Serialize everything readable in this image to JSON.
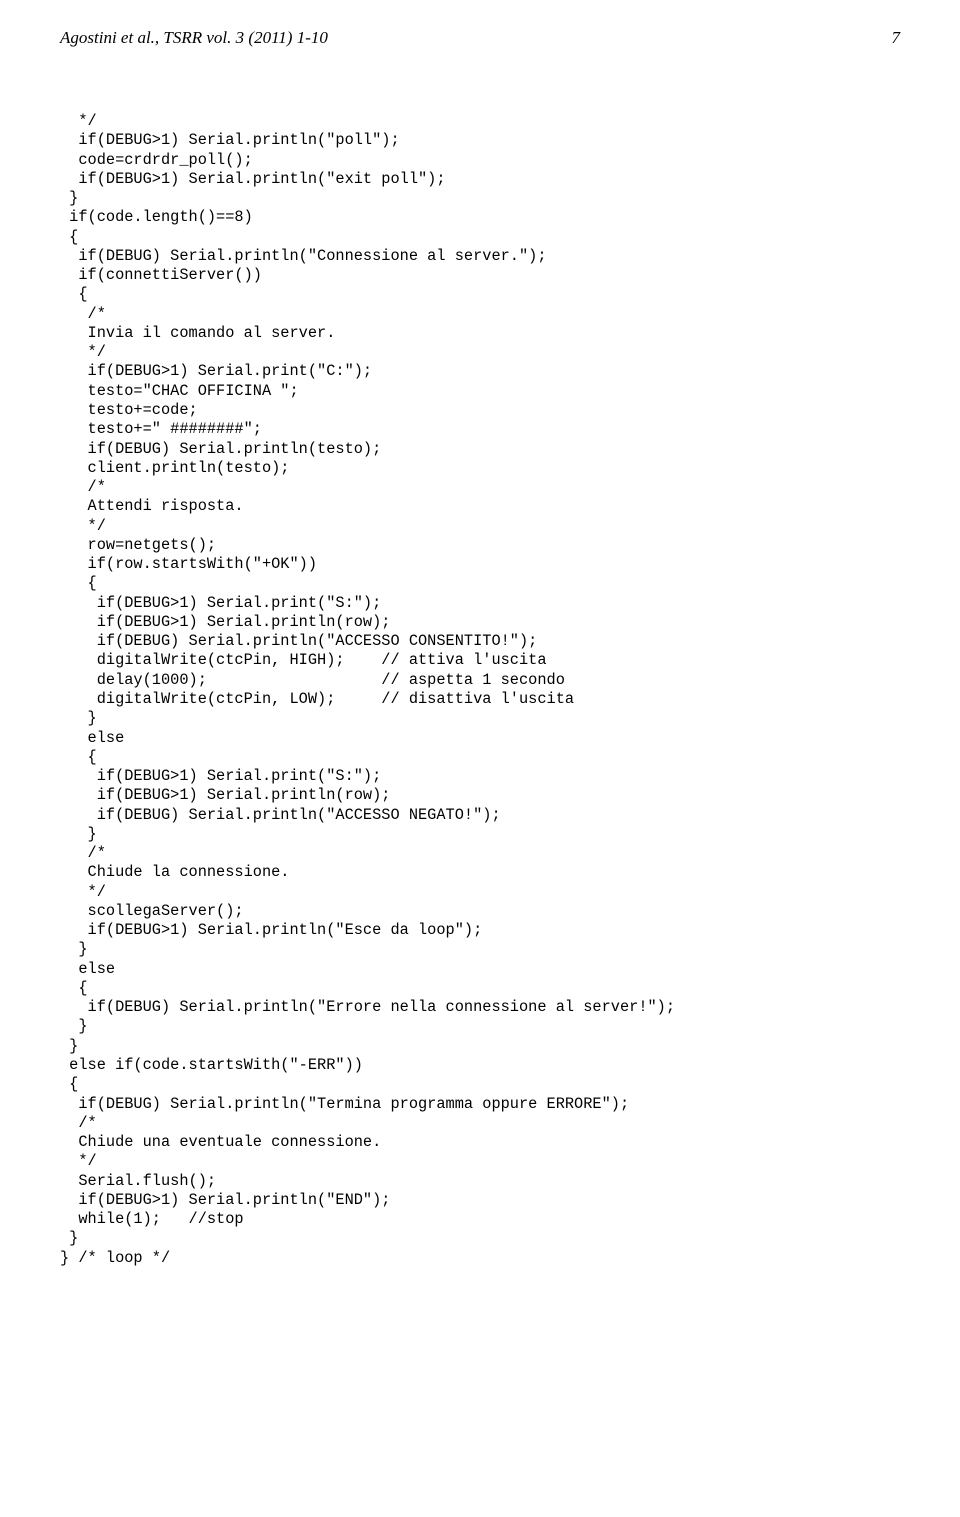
{
  "header": {
    "left": "Agostini et al., TSRR vol. 3 (2011) 1-10",
    "right": "7"
  },
  "code": "  */\n  if(DEBUG>1) Serial.println(\"poll\");\n  code=crdrdr_poll();\n  if(DEBUG>1) Serial.println(\"exit poll\");\n }\n if(code.length()==8)\n {\n  if(DEBUG) Serial.println(\"Connessione al server.\");\n  if(connettiServer())\n  {\n   /*\n   Invia il comando al server.\n   */\n   if(DEBUG>1) Serial.print(\"C:\");\n   testo=\"CHAC OFFICINA \";\n   testo+=code;\n   testo+=\" ########\";\n   if(DEBUG) Serial.println(testo);\n   client.println(testo);\n   /*\n   Attendi risposta.\n   */\n   row=netgets();\n   if(row.startsWith(\"+OK\"))\n   {\n    if(DEBUG>1) Serial.print(\"S:\");\n    if(DEBUG>1) Serial.println(row);\n    if(DEBUG) Serial.println(\"ACCESSO CONSENTITO!\");\n    digitalWrite(ctcPin, HIGH);    // attiva l'uscita\n    delay(1000);                   // aspetta 1 secondo\n    digitalWrite(ctcPin, LOW);     // disattiva l'uscita\n   }\n   else\n   {\n    if(DEBUG>1) Serial.print(\"S:\");\n    if(DEBUG>1) Serial.println(row);\n    if(DEBUG) Serial.println(\"ACCESSO NEGATO!\");\n   }\n   /*\n   Chiude la connessione.\n   */\n   scollegaServer();\n   if(DEBUG>1) Serial.println(\"Esce da loop\");\n  }\n  else\n  {\n   if(DEBUG) Serial.println(\"Errore nella connessione al server!\");\n  }\n }\n else if(code.startsWith(\"-ERR\"))\n {\n  if(DEBUG) Serial.println(\"Termina programma oppure ERRORE\");\n  /*\n  Chiude una eventuale connessione.\n  */\n  Serial.flush();\n  if(DEBUG>1) Serial.println(\"END\");\n  while(1);   //stop\n }\n} /* loop */"
}
